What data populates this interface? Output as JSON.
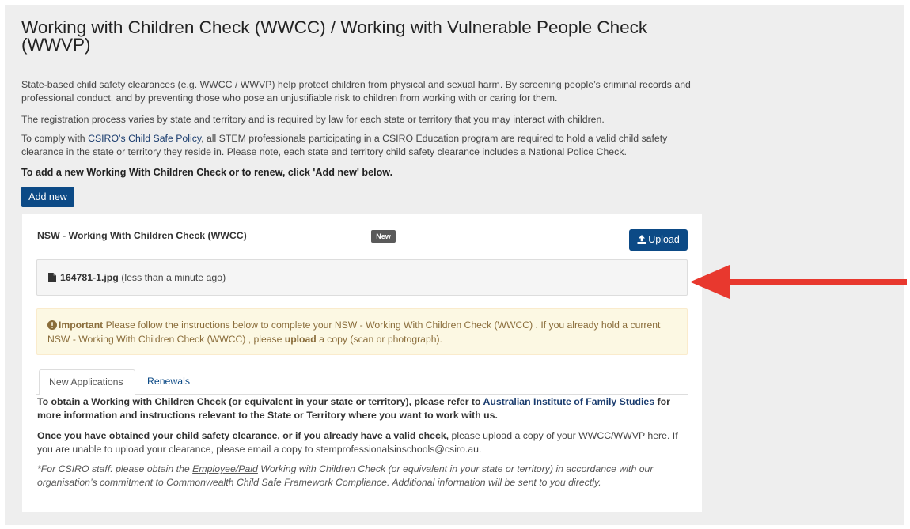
{
  "page": {
    "title": "Working with Children Check (WWCC) / Working with Vulnerable People Check (WWVP)",
    "intro_1": "State-based child safety clearances (e.g. WWCC / WWVP) help protect children from physical and sexual harm. By screening people’s criminal records and professional conduct, and by preventing those who pose an unjustifiable risk to children from working with or caring for them.",
    "intro_2": "The registration process varies by state and territory and is required by law for each state or territory that you may interact with children.",
    "intro_3_prefix": "To comply with ",
    "intro_3_link": "CSIRO’s Child Safe Policy",
    "intro_3_suffix": ", all STEM professionals participating in a CSIRO Education program are required to hold a valid child safety clearance in the state or territory they reside in. Please note, each state and territory child safety clearance includes a National Police Check.",
    "add_instruction": "To add a new Working With Children Check or to renew, click 'Add new' below.",
    "add_new_label": "Add new"
  },
  "card": {
    "title": "NSW  - Working With Children Check (WWCC)",
    "badge": "New",
    "upload_label": "Upload",
    "file_name": "164781-1.jpg",
    "file_time": "(less than a minute ago)",
    "alert_strong": "Important",
    "alert_text_1": " Please follow the instructions below to complete your NSW  - Working With Children Check (WWCC) . If you already hold a current NSW  - Working With Children Check (WWCC) , please ",
    "alert_upload": "upload",
    "alert_text_2": " a copy (scan or photograph).",
    "tabs": [
      {
        "label": "New Applications",
        "active": true
      },
      {
        "label": "Renewals",
        "active": false
      }
    ],
    "body_1_prefix": "To obtain a Working with Children Check (or equivalent in your state or territory), please refer to ",
    "body_1_link": "Australian Institute of Family Studies",
    "body_1_suffix": " for more information and instructions relevant to the State or Territory where you want to work with us.",
    "body_2_strong": "Once you have obtained your child safety clearance, or if you already have a valid check,",
    "body_2_text": " please upload a copy of your WWCC/WWVP here. If you are unable to upload your clearance, please email a copy to stemprofessionalsinschools@csiro.au.",
    "body_3_prefix": "*For CSIRO staff: please obtain the ",
    "body_3_underline": "Employee/Paid",
    "body_3_suffix": " Working with Children Check (or equivalent in your state or territory) in accordance with our organisation’s commitment to Commonwealth Child Safe Framework Compliance. Additional information will be sent to you directly."
  },
  "colors": {
    "primary": "#0c4a86",
    "arrow": "#e8382e",
    "alert_bg": "#fcf8e3",
    "alert_text": "#8a6d3b"
  },
  "icons": {
    "upload": "upload-icon",
    "file": "file-icon",
    "warning": "exclamation-circle-icon",
    "annotation": "red-arrow-icon"
  }
}
